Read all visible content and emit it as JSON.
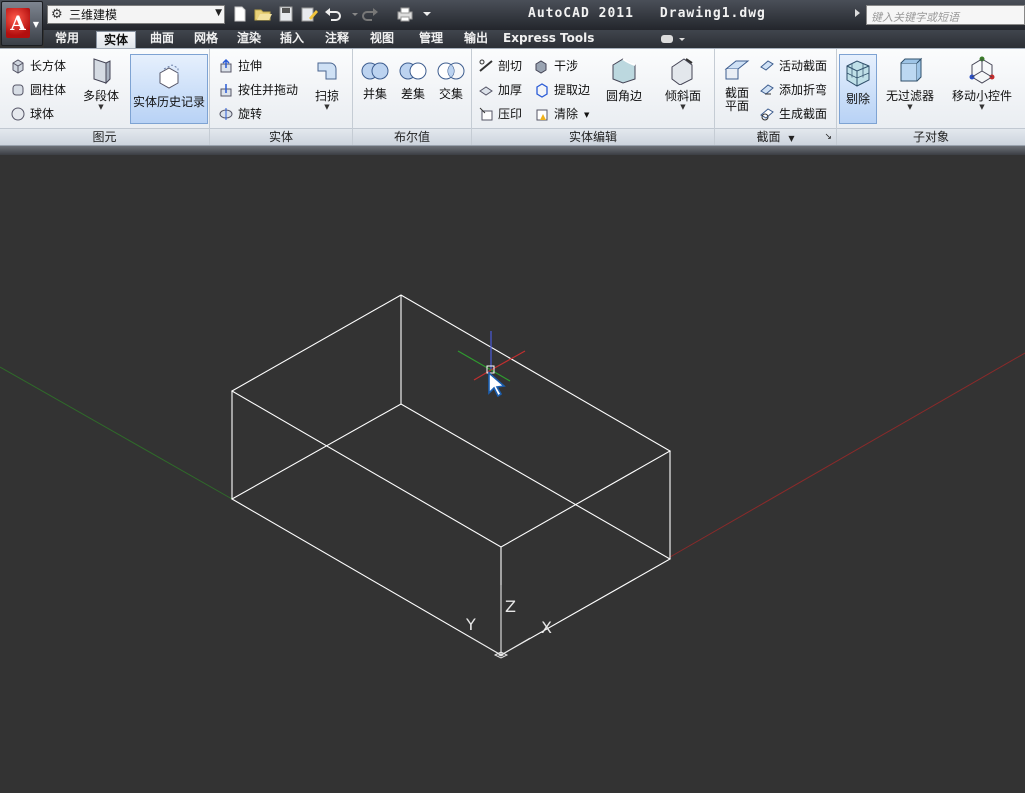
{
  "app": {
    "app_name": "AutoCAD 2011",
    "document_name": "Drawing1.dwg",
    "workspace": "三维建模",
    "help_placeholder": "键入关键字或短语"
  },
  "tabs": [
    {
      "label": "常用"
    },
    {
      "label": "实体"
    },
    {
      "label": "曲面"
    },
    {
      "label": "网格"
    },
    {
      "label": "渲染"
    },
    {
      "label": "插入"
    },
    {
      "label": "注释"
    },
    {
      "label": "视图"
    },
    {
      "label": "管理"
    },
    {
      "label": "输出"
    },
    {
      "label": "Express Tools"
    }
  ],
  "ribbon": {
    "primitive": {
      "title": "图元",
      "box": "长方体",
      "cylinder": "圆柱体",
      "sphere": "球体",
      "polysolid": "多段体",
      "solid_history": "实体历史记录"
    },
    "solid": {
      "title": "实体",
      "extrude": "拉伸",
      "presspull": "按住并拖动",
      "revolve": "旋转",
      "sweep": "扫掠"
    },
    "boolean": {
      "title": "布尔值",
      "union": "并集",
      "subtract": "差集",
      "intersect": "交集"
    },
    "solid_editing": {
      "title": "实体编辑",
      "slice": "剖切",
      "interfere": "干涉",
      "thicken": "加厚",
      "extract_edges": "提取边",
      "imprint": "压印",
      "clean": "清除",
      "fillet_edge": "圆角边",
      "chamfer_edge": "倾斜面"
    },
    "section": {
      "title": "截面",
      "section_plane_line1": "截面",
      "section_plane_line2": "平面",
      "live_section": "活动截面",
      "add_jog": "添加折弯",
      "generate_section": "生成截面"
    },
    "subobject": {
      "title": "子对象",
      "culling": "剔除",
      "no_filter": "无过滤器",
      "move_gizmo": "移动小控件"
    }
  },
  "drawing": {
    "ucs_x": "X",
    "ucs_y": "Y",
    "ucs_z": "Z",
    "background_color": "#333333",
    "x_axis_color": "#8b2a2a",
    "y_axis_color": "#2f6b2a",
    "wire_color": "#ffffff"
  }
}
